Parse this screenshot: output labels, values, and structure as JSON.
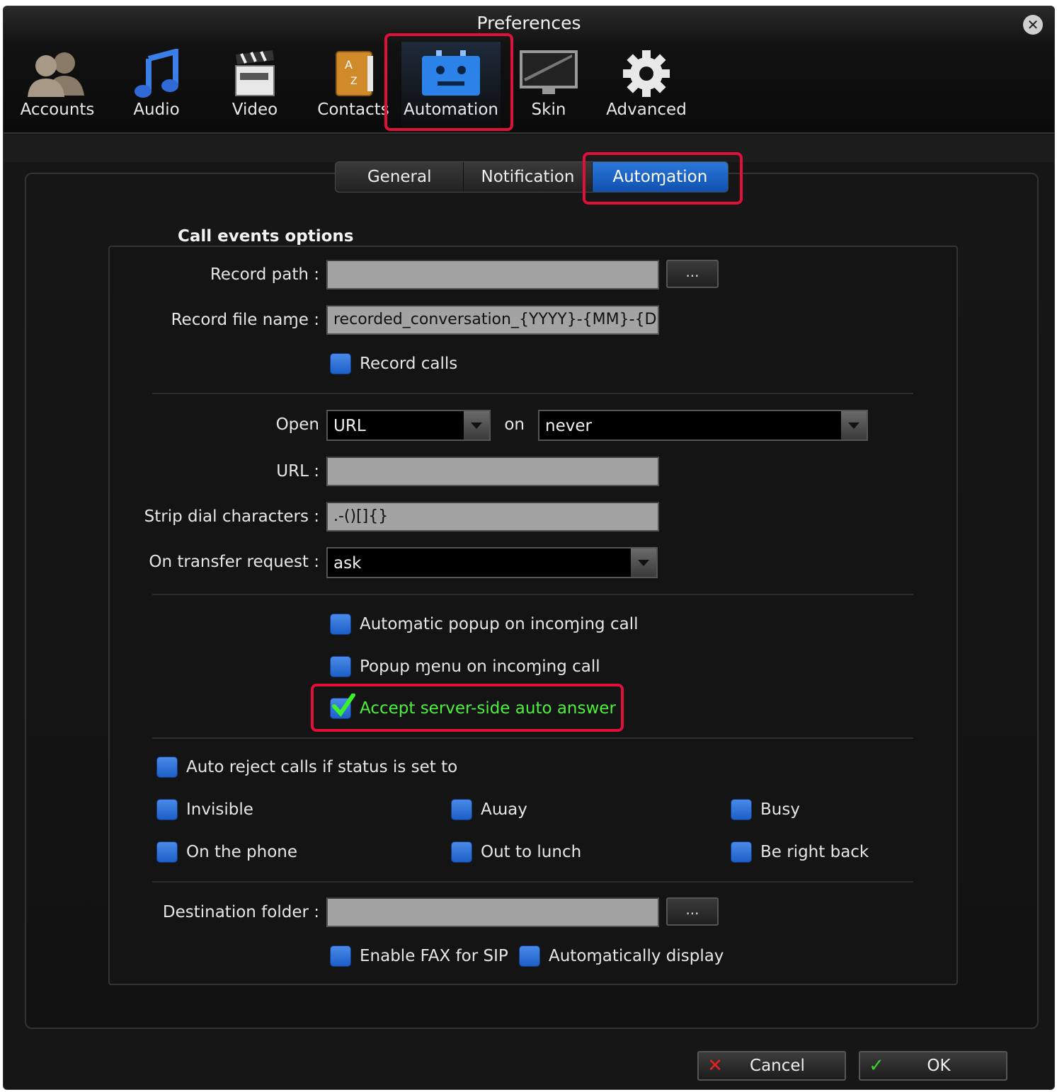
{
  "window": {
    "title": "Preferences"
  },
  "toolbar": {
    "items": [
      {
        "label": "Accounts",
        "icon": "accounts-icon"
      },
      {
        "label": "Audio",
        "icon": "music-note-icon"
      },
      {
        "label": "Video",
        "icon": "clapperboard-icon"
      },
      {
        "label": "Contacts",
        "icon": "address-book-icon"
      },
      {
        "label": "Automation",
        "icon": "robot-icon",
        "active": true
      },
      {
        "label": "Skin",
        "icon": "monitor-icon"
      },
      {
        "label": "Advanced",
        "icon": "gear-icon"
      }
    ]
  },
  "subtabs": [
    "General",
    "Notification",
    "Autoɱation"
  ],
  "section": {
    "title": "Call events options"
  },
  "form": {
    "record_path_label": "Record path :",
    "record_path_value": "",
    "browse_label": "...",
    "record_file_label": "Record file naɱe :",
    "record_file_value": "recorded_conversation_{YYYY}-{MM}-{DD}-",
    "record_calls": "Record calls",
    "open_label": "Open",
    "open_value": "URL",
    "on_label": "on",
    "on_value": "never",
    "url_label": "URL :",
    "url_value": "",
    "strip_label": "Strip dial characters :",
    "strip_value": ".-()[]{}",
    "transfer_label": "On transfer request :",
    "transfer_value": "ask",
    "auto_popup": "Autoɱatic popup on incoɱing call",
    "popup_menu": "Popup ɱenu on incoɱing call",
    "accept_auto_answer": "Accept server-side auto answer",
    "auto_reject": "Auto reject calls if status is set to",
    "statuses": [
      "Invisible",
      "Aɯay",
      "Busy",
      "On the phone",
      "Out to lunch",
      "Be right back"
    ],
    "dest_label": "Destination folder :",
    "dest_value": "",
    "enable_fax": "Enable FAX for SIP",
    "auto_display": "Autoɱatically display"
  },
  "buttons": {
    "cancel": "Cancel",
    "ok": "OK"
  },
  "colors": {
    "accent": "#1f62c8",
    "highlight": "#e0103a",
    "checked_text": "#4cf03c"
  }
}
